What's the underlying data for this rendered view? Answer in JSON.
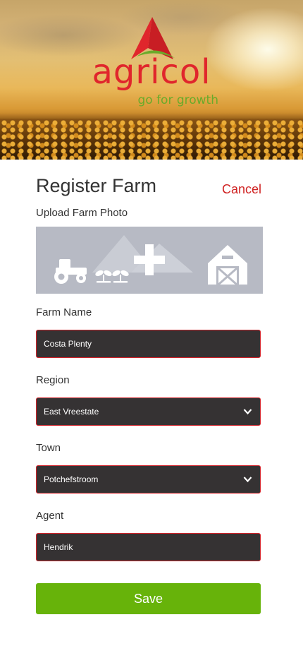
{
  "brand": {
    "name": "agricol",
    "tagline": "go for growth",
    "colors": {
      "red": "#e0262c",
      "green": "#6aaa2a",
      "button": "#67b30a",
      "field": "#353233"
    }
  },
  "header": {
    "title": "Register Farm",
    "cancel_label": "Cancel"
  },
  "photo": {
    "label": "Upload Farm Photo",
    "icons": [
      "tractor-icon",
      "seedlings-icon",
      "plus-icon",
      "barn-icon"
    ]
  },
  "form": {
    "farm_name": {
      "label": "Farm Name",
      "value": "Costa Plenty"
    },
    "region": {
      "label": "Region",
      "value": "East Vreestate"
    },
    "town": {
      "label": "Town",
      "value": "Potchefstroom"
    },
    "agent": {
      "label": "Agent",
      "value": "Hendrik"
    }
  },
  "actions": {
    "save_label": "Save"
  }
}
